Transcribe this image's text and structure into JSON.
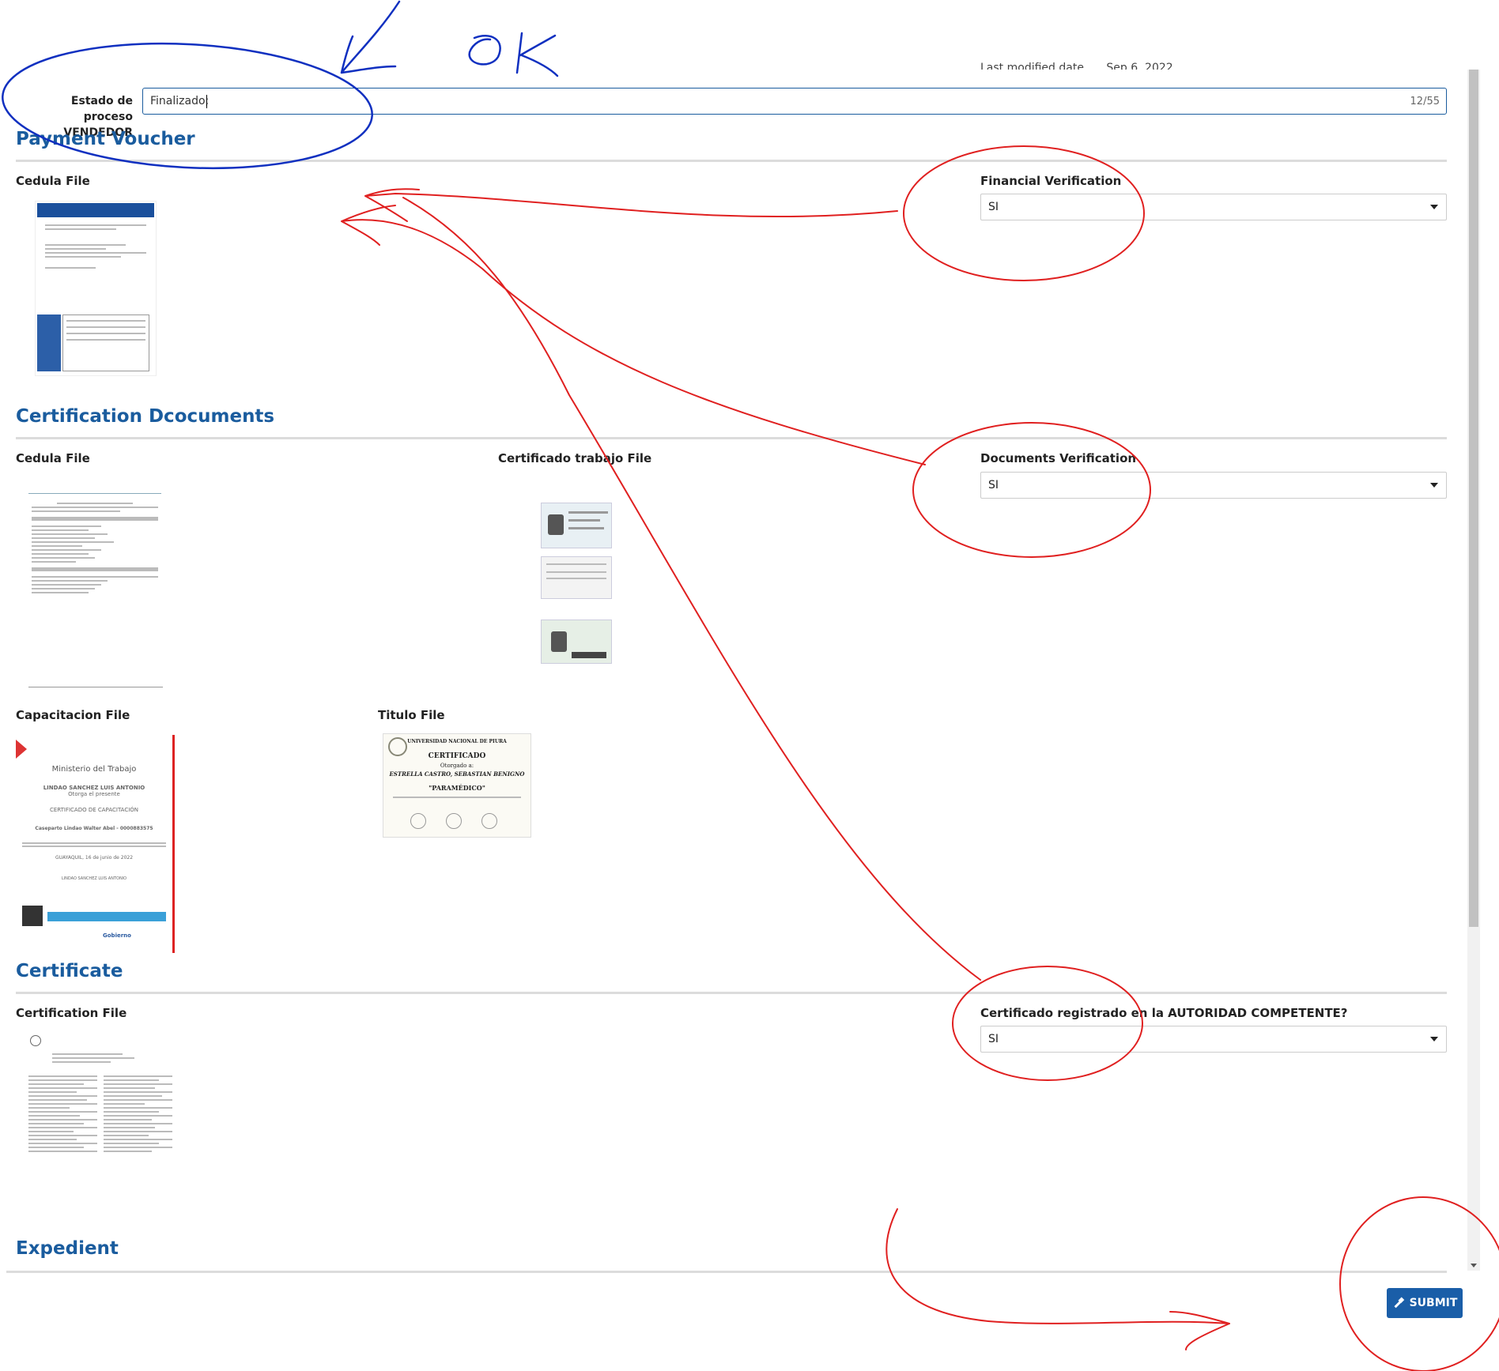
{
  "header": {
    "modified_label": "Last modified date",
    "modified_value": "Sep 6, 2022"
  },
  "status": {
    "label_line1": "Estado de proceso",
    "label_line2": "VENDEDOR",
    "value": "Finalizado;",
    "counter": "12/55"
  },
  "sections": {
    "payment": {
      "title": "Payment Voucher",
      "file_label": "Cedula File",
      "verification_label": "Financial Verification",
      "verification_value": "SI"
    },
    "certification": {
      "title": "Certification Dcocuments",
      "cedula_label": "Cedula File",
      "trabajo_label": "Certificado trabajo File",
      "verification_label": "Documents Verification",
      "verification_value": "SI",
      "capacitacion_label": "Capacitacion File",
      "titulo_label": "Titulo File"
    },
    "certificate": {
      "title": "Certificate",
      "file_label": "Certification File",
      "registered_label": "Certificado registrado en la AUTORIDAD COMPETENTE?",
      "registered_value": "SI"
    },
    "expedient": {
      "title": "Expedient"
    }
  },
  "thumbnails": {
    "capacitacion": {
      "ministry": "Ministerio del Trabajo",
      "name": "LINDAO SANCHEZ LUIS ANTONIO",
      "subtitle": "Otorga el presente",
      "cert_type": "CERTIFICADO DE CAPACITACIÓN",
      "recipient": "Caseparto Lindao Walter Abel - 0000883575",
      "place_date": "GUAYAQUIL, 16 de junio de 2022",
      "signer": "LINDAO SANCHEZ LUIS ANTONIO",
      "gov": "Gobierno"
    },
    "titulo": {
      "university": "UNIVERSIDAD NACIONAL DE PIURA",
      "heading": "CERTIFICADO",
      "otorgado": "Otorgado a:",
      "person": "ESTRELLA CASTRO, SEBASTIAN BENIGNO",
      "degree": "\"PARAMÉDICO\""
    }
  },
  "actions": {
    "submit_label": "SUBMIT"
  },
  "annotations": {
    "ok_text": "OK"
  },
  "colors": {
    "accent": "#1a5c9e",
    "button": "#1a5ea8",
    "annotation_red": "#e02020",
    "annotation_blue": "#1030c0"
  }
}
